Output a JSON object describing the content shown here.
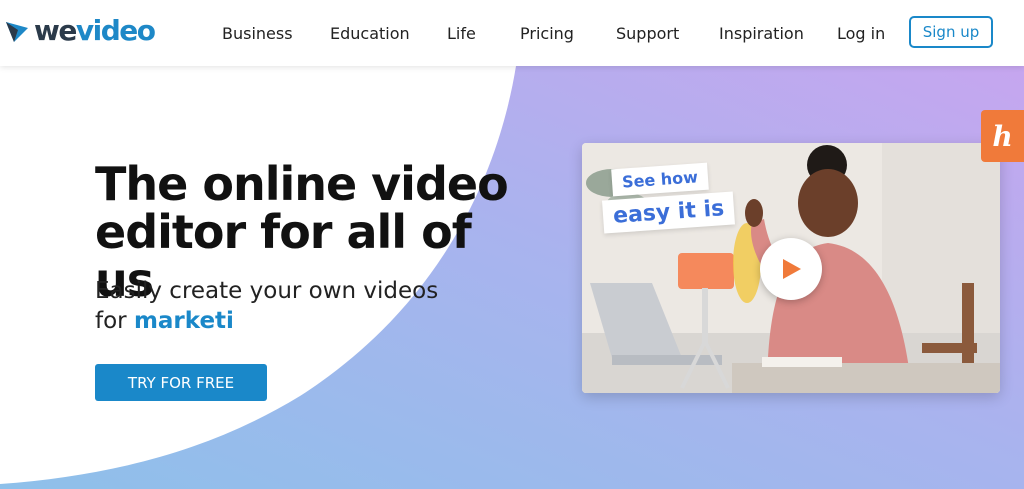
{
  "logo": {
    "part1": "we",
    "part2": "video"
  },
  "nav": {
    "items": [
      "Business",
      "Education",
      "Life",
      "Pricing",
      "Support",
      "Inspiration"
    ],
    "login": "Log in",
    "signup": "Sign up"
  },
  "hero": {
    "headline": "The online video editor for all of us",
    "subline_prefix": "Easily create your own videos",
    "subline_for": "for",
    "subline_accent": "marketi",
    "cta": "TRY FOR FREE"
  },
  "video": {
    "caption_line1": "See how",
    "caption_line2": "easy it is"
  },
  "badge": {
    "letter": "h"
  },
  "colors": {
    "accent": "#1a88c9",
    "headline": "#111111",
    "gradient_start": "#8ec0ea",
    "gradient_end": "#c6a6ef",
    "badge": "#f07a3a"
  }
}
